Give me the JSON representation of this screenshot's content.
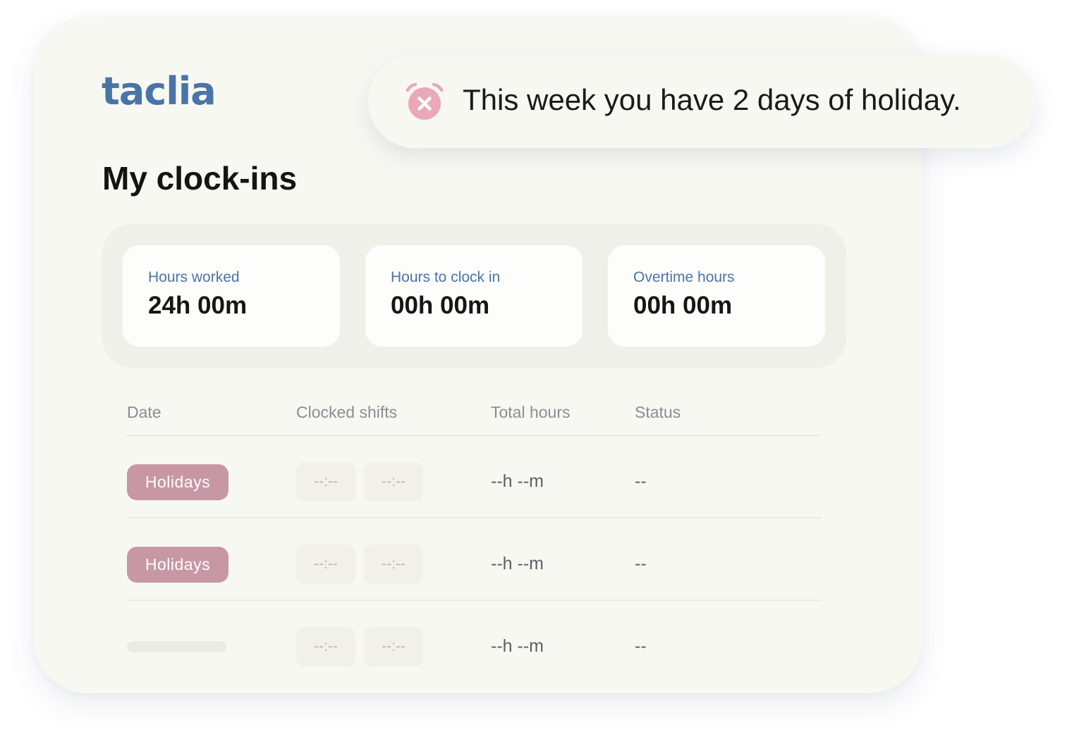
{
  "app": {
    "logo": "taclia"
  },
  "toast": {
    "icon": "alarm-clock-cancel-icon",
    "message": "This week you have 2 days of holiday."
  },
  "page": {
    "title": "My clock-ins"
  },
  "stats": [
    {
      "label": "Hours worked",
      "value": "24h 00m"
    },
    {
      "label": "Hours to clock in",
      "value": "00h 00m"
    },
    {
      "label": "Overtime hours",
      "value": "00h 00m"
    }
  ],
  "table": {
    "columns": [
      "Date",
      "Clocked shifts",
      "Total hours",
      "Status"
    ],
    "rows": [
      {
        "date": "Holidays",
        "shift_in": "--:--",
        "shift_out": "--:--",
        "total": "--h --m",
        "status": "--"
      },
      {
        "date": "Holidays",
        "shift_in": "--:--",
        "shift_out": "--:--",
        "total": "--h --m",
        "status": "--"
      },
      {
        "date": "",
        "shift_in": "--:--",
        "shift_out": "--:--",
        "total": "--h --m",
        "status": "--"
      }
    ]
  },
  "colors": {
    "brand": "#4a74a8",
    "holiday_badge": "#c897a4",
    "alert_icon": "#eba8b8",
    "card_background": "#f8f8f3"
  }
}
